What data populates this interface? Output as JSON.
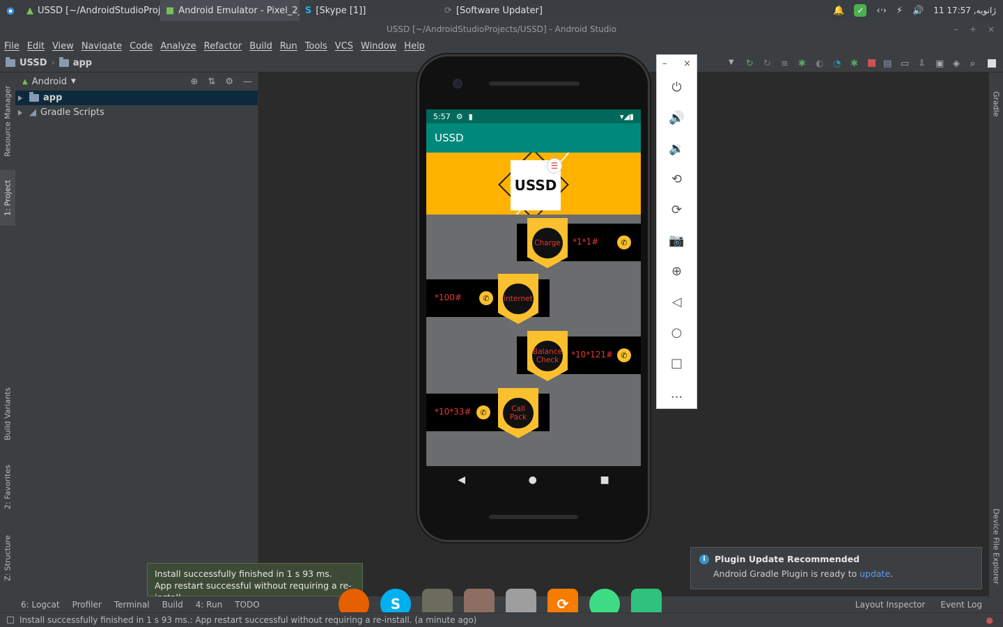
{
  "taskbar": {
    "tasks": [
      {
        "label": "USSD [~/AndroidStudioProje...",
        "active": false
      },
      {
        "label": "Android Emulator - Pixel_2_A...",
        "active": true
      },
      {
        "label": "[Skype [1]]",
        "active": false
      },
      {
        "label": "[Software Updater]",
        "active": false
      }
    ],
    "clock": "11 ژانویه, 17:57"
  },
  "window": {
    "title": "USSD [~/AndroidStudioProjects/USSD] - Android Studio"
  },
  "menu": [
    "File",
    "Edit",
    "View",
    "Navigate",
    "Code",
    "Analyze",
    "Refactor",
    "Build",
    "Run",
    "Tools",
    "VCS",
    "Window",
    "Help"
  ],
  "breadcrumb": {
    "project": "USSD",
    "module": "app"
  },
  "project_panel": {
    "view_mode": "Android",
    "items": [
      {
        "label": "app",
        "selected": true
      },
      {
        "label": "Gradle Scripts",
        "selected": false
      }
    ]
  },
  "left_tabs": [
    "Resource Manager",
    "1: Project",
    "Build Variants",
    "2: Favorites",
    "Z: Structure"
  ],
  "right_tabs": [
    "Gradle",
    "Device File Explorer"
  ],
  "phone": {
    "status_time": "5:57",
    "app_title": "USSD",
    "banner_text": "USSD",
    "rows": [
      {
        "label": "Charge",
        "code": "*1*1#"
      },
      {
        "label": "internet",
        "code": "*100#"
      },
      {
        "label": "Balance Check",
        "code": "*10*121#"
      },
      {
        "label": "Call Pack",
        "code": "*10*33#"
      }
    ]
  },
  "emulator_panel": {
    "more": "..."
  },
  "bottom_tools": {
    "left": [
      "6: Logcat",
      "Profiler",
      "Terminal",
      "Build",
      "4: Run",
      "TODO"
    ],
    "right": [
      "Layout Inspector",
      "Event Log"
    ]
  },
  "tooltip": {
    "line1": "Install successfully finished in 1 s 93 ms.",
    "line2": "App restart successful without requiring a re-install."
  },
  "status_bar": {
    "text": "Install successfully finished in 1 s 93 ms.: App restart successful without requiring a re-install. (a minute ago)"
  },
  "notification": {
    "title": "Plugin Update Recommended",
    "body": "Android Gradle Plugin is ready to",
    "link": "update",
    "suffix": "."
  },
  "colors": {
    "accent_teal": "#00897b",
    "banner_yellow": "#ffb300",
    "code_red": "#e53935"
  }
}
